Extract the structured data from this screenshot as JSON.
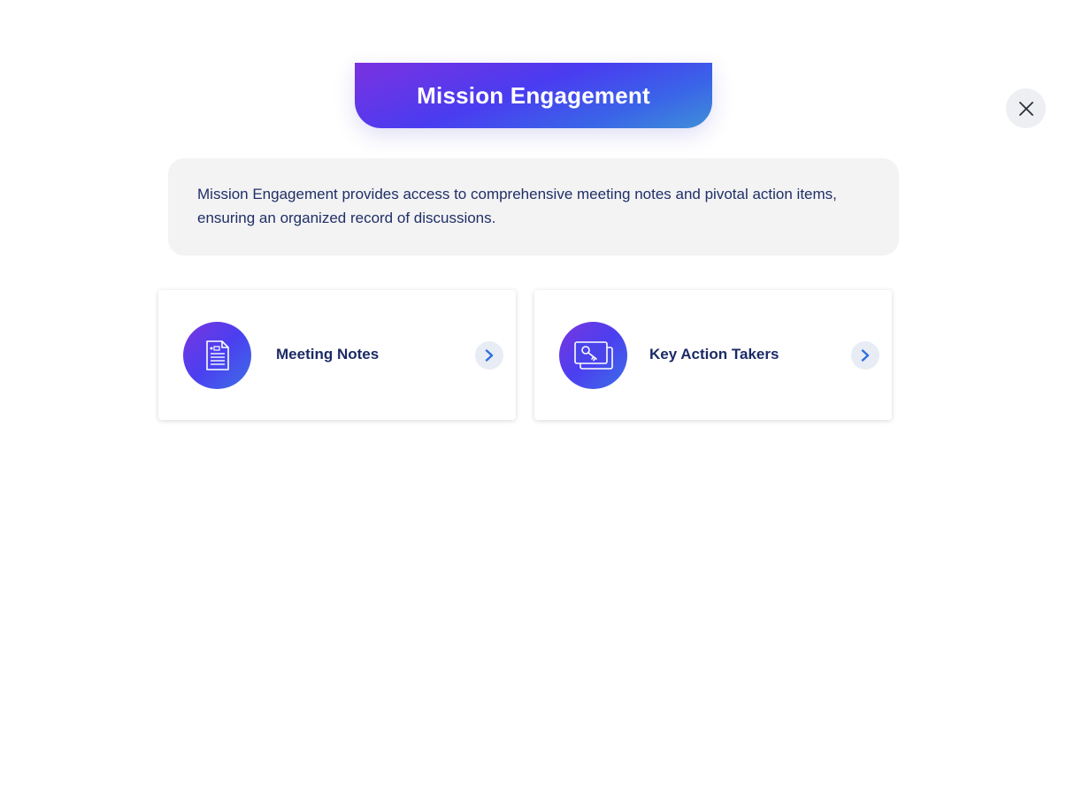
{
  "header": {
    "title": "Mission Engagement"
  },
  "close_button": {
    "icon": "close-icon"
  },
  "description": {
    "text": "Mission Engagement provides access to comprehensive meeting notes and pivotal action items, ensuring an organized record of discussions."
  },
  "cards": [
    {
      "label": "Meeting Notes",
      "icon": "document-icon",
      "chevron": "chevron-right-icon"
    },
    {
      "label": "Key Action Takers",
      "icon": "key-cards-icon",
      "chevron": "chevron-right-icon"
    }
  ],
  "colors": {
    "title_gradient_start": "#7a32e0",
    "title_gradient_mid": "#4a3cf0",
    "title_gradient_end": "#3f8fd8",
    "text_navy": "#1c2b66",
    "chevron_blue": "#2f6fe0",
    "description_bg": "#f3f3f4"
  }
}
